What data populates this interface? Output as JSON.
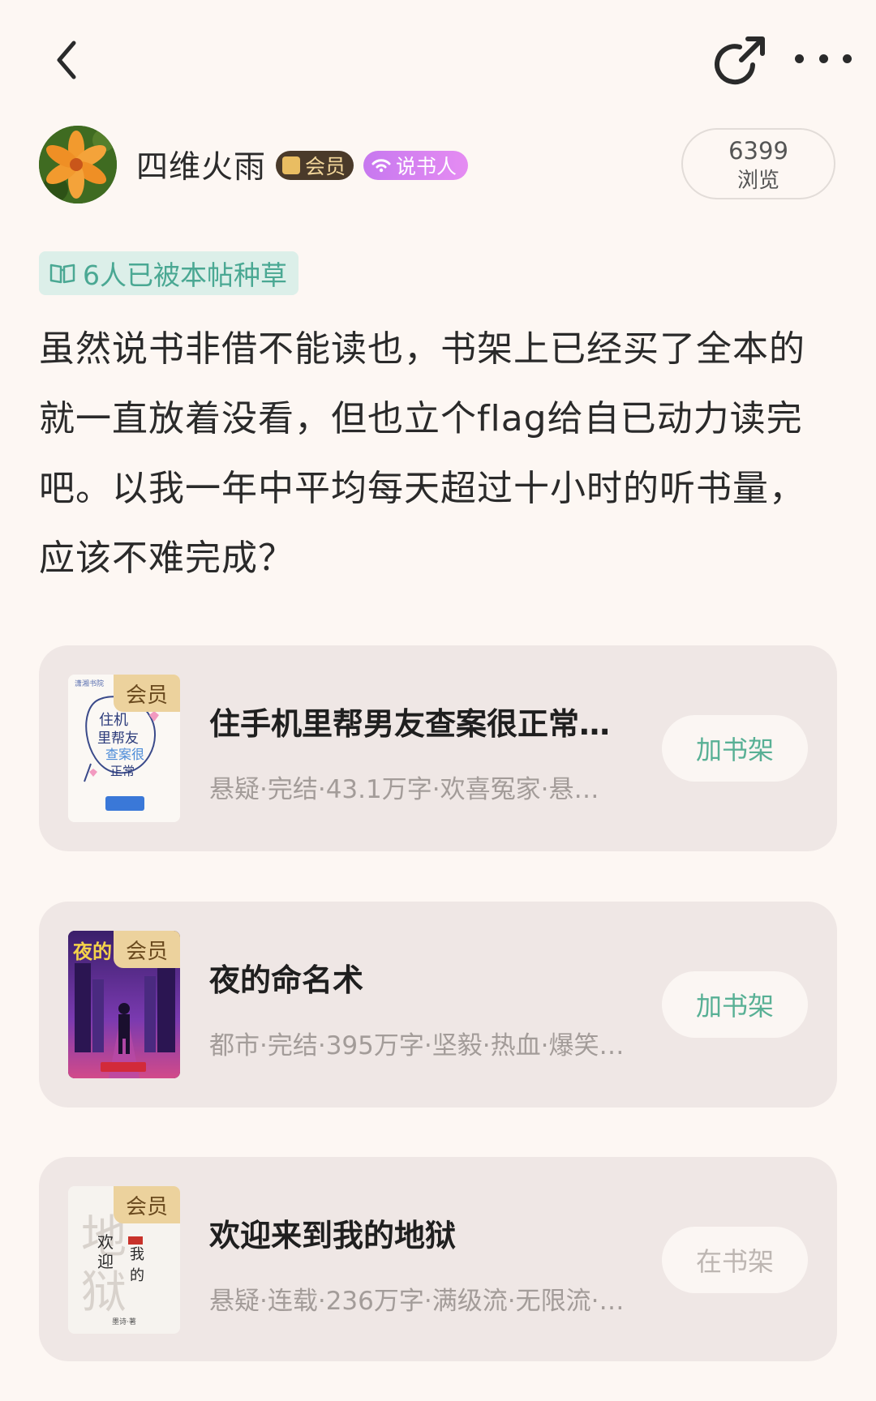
{
  "header": {
    "back_icon": "chevron-left-icon",
    "share_icon": "share-icon",
    "more_icon": "more-dots-icon"
  },
  "author": {
    "name": "四维火雨",
    "vip_badge": "会员",
    "teller_badge": "说书人",
    "views_count": "6399",
    "views_label": "浏览"
  },
  "grass_tag": "6人已被本帖种草",
  "post": {
    "lines": [
      "虽然说书非借不能读也，书架上已经买了全本的",
      "就一直放着没看，但也立个flag给自已动力读完",
      "吧。以我一年中平均每天超过十小时的听书量，",
      "应该不难完成？"
    ]
  },
  "books": [
    {
      "vip": "会员",
      "title": "住手机里帮男友查案很正常…",
      "meta": "悬疑·完结·43.1万字·欢喜冤家·悬…",
      "button": "加书架",
      "in_shelf": false
    },
    {
      "vip": "会员",
      "title": "夜的命名术",
      "meta": "都市·完结·395万字·坚毅·热血·爆笑…",
      "button": "加书架",
      "in_shelf": false
    },
    {
      "vip": "会员",
      "title": "欢迎来到我的地狱",
      "meta": "悬疑·连载·236万字·满级流·无限流·…",
      "button": "在书架",
      "in_shelf": true
    }
  ],
  "colors": {
    "background": "#fdf7f3",
    "accent_green": "#58b095",
    "vip_gold": "#ecd29d",
    "teller_purple": "#d47ff0"
  }
}
